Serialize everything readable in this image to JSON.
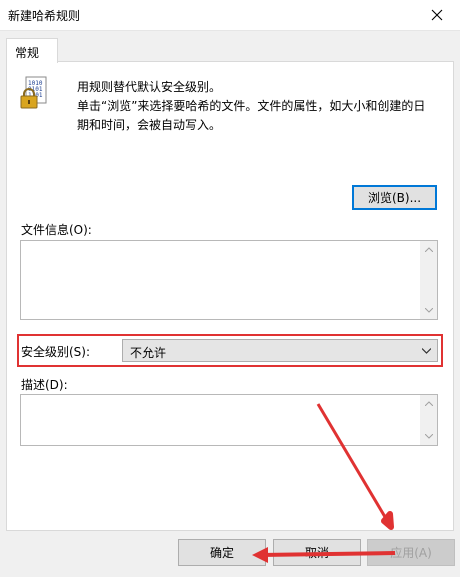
{
  "window": {
    "title": "新建哈希规则"
  },
  "tabs": [
    {
      "label": "常规"
    }
  ],
  "info": {
    "line1": "用规则替代默认安全级别。",
    "line2": "单击“浏览”来选择要哈希的文件。文件的属性，如大小和创建的日期和时间，会被自动写入。"
  },
  "browse": {
    "label": "浏览(B)..."
  },
  "file_info": {
    "label": "文件信息(O):",
    "value": ""
  },
  "security": {
    "label": "安全级别(S):",
    "value": "不允许"
  },
  "description": {
    "label": "描述(D):",
    "value": ""
  },
  "footer": {
    "ok": "确定",
    "cancel": "取消",
    "apply": "应用(A)"
  },
  "colors": {
    "highlight": "#e03232",
    "focus": "#0078d7"
  },
  "icons": {
    "close": "close-icon",
    "document": "binary-document-lock-icon"
  }
}
